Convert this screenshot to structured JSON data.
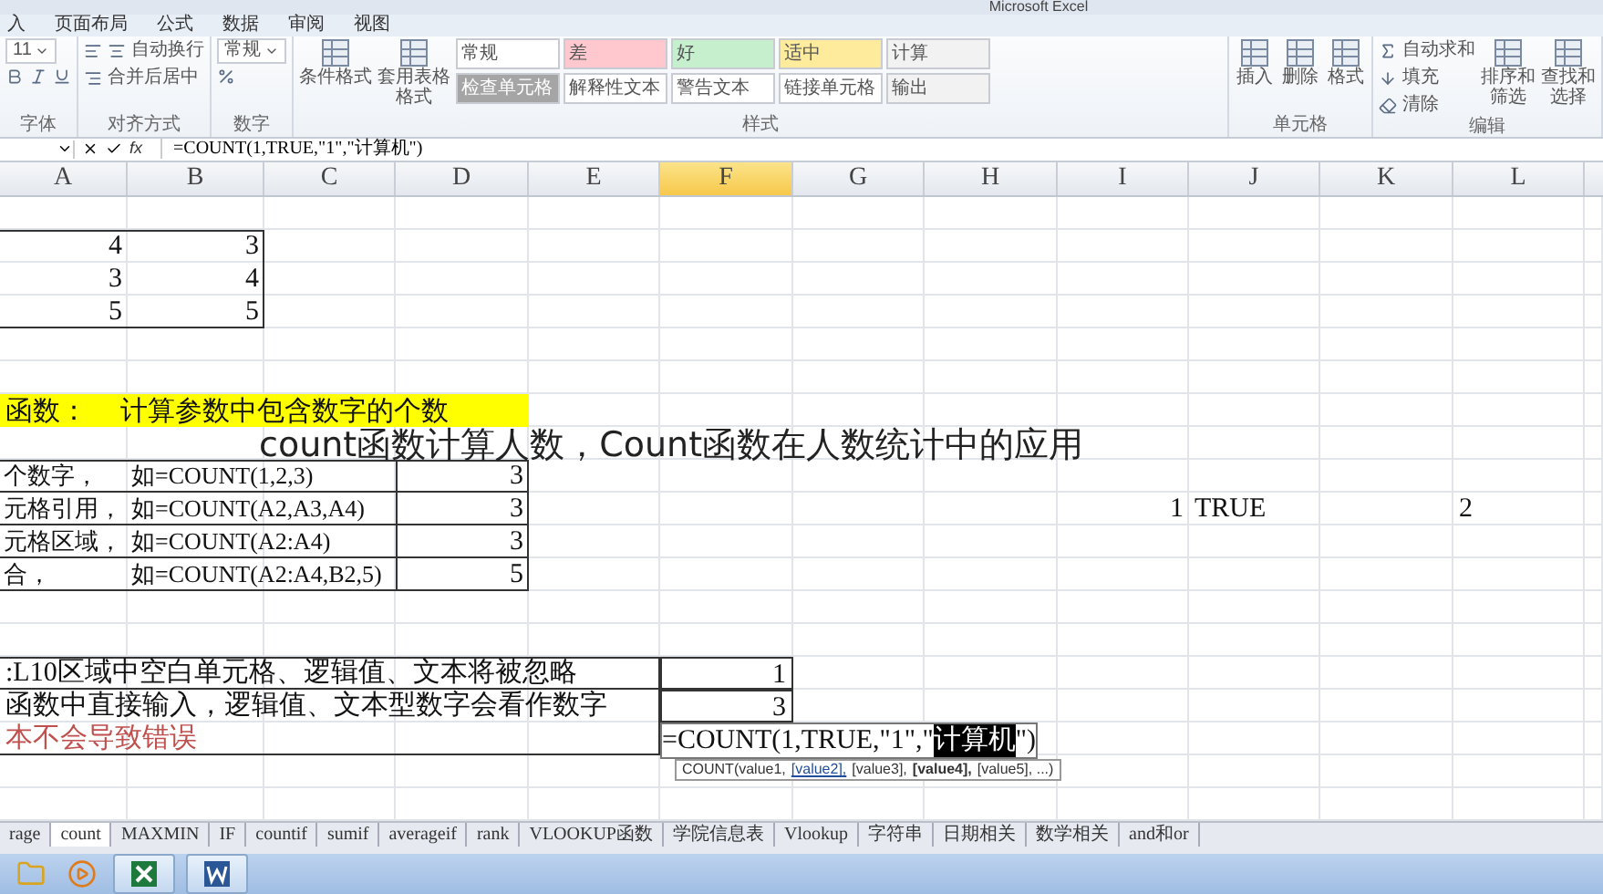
{
  "window": {
    "title": "Microsoft Excel"
  },
  "menu_tabs": [
    {
      "label": "入",
      "selected": false
    },
    {
      "label": "页面布局",
      "selected": false
    },
    {
      "label": "公式",
      "selected": false
    },
    {
      "label": "数据",
      "selected": false
    },
    {
      "label": "审阅",
      "selected": false
    },
    {
      "label": "视图",
      "selected": false
    }
  ],
  "ribbon": {
    "groups": [
      {
        "label": "字体",
        "kind": "font",
        "items": [
          {
            "kind": "field",
            "label": "11"
          }
        ]
      },
      {
        "label": "对齐方式",
        "kind": "align",
        "items": [
          {
            "kind": "small",
            "label": "自动换行"
          },
          {
            "kind": "small",
            "label": "合并后居中"
          }
        ]
      },
      {
        "label": "数字",
        "kind": "number",
        "items": [
          {
            "kind": "field",
            "label": "常规"
          }
        ]
      },
      {
        "label": "样式",
        "kind": "styles",
        "items": [
          {
            "kind": "big",
            "label": "条件格式"
          },
          {
            "kind": "big",
            "label": "套用表格格式"
          }
        ],
        "swatches": [
          {
            "label": "常规",
            "color": "#ffffff"
          },
          {
            "label": "差",
            "color": "#ffc7ce"
          },
          {
            "label": "好",
            "color": "#c6efce"
          },
          {
            "label": "适中",
            "color": "#ffeb9c"
          },
          {
            "label": "计算",
            "color": "#f2f2f2"
          },
          {
            "label": "检查单元格",
            "color": "#a5a5a5"
          },
          {
            "label": "解释性文本",
            "color": "#ffffff"
          },
          {
            "label": "警告文本",
            "color": "#ffffff"
          },
          {
            "label": "链接单元格",
            "color": "#ffffff"
          },
          {
            "label": "输出",
            "color": "#f2f2f2"
          }
        ]
      },
      {
        "label": "单元格",
        "kind": "cells",
        "items": [
          {
            "kind": "big",
            "label": "插入"
          },
          {
            "kind": "big",
            "label": "删除"
          },
          {
            "kind": "big",
            "label": "格式"
          }
        ]
      },
      {
        "label": "编辑",
        "kind": "editing",
        "items": [
          {
            "kind": "small",
            "label": "自动求和"
          },
          {
            "kind": "small",
            "label": "填充"
          },
          {
            "kind": "small",
            "label": "清除"
          },
          {
            "kind": "big",
            "label": "排序和筛选"
          },
          {
            "kind": "big",
            "label": "查找和选择"
          }
        ]
      }
    ]
  },
  "formula_bar": {
    "fx": "fx",
    "formula": "=COUNT(1,TRUE,\"1\",\"计算机\")"
  },
  "columns": [
    {
      "label": "A",
      "selected": false
    },
    {
      "label": "B",
      "selected": false
    },
    {
      "label": "C",
      "selected": false
    },
    {
      "label": "D",
      "selected": false
    },
    {
      "label": "E",
      "selected": false
    },
    {
      "label": "F",
      "selected": true
    },
    {
      "label": "G",
      "selected": false
    },
    {
      "label": "H",
      "selected": false
    },
    {
      "label": "I",
      "selected": false
    },
    {
      "label": "J",
      "selected": false
    },
    {
      "label": "K",
      "selected": false
    },
    {
      "label": "L",
      "selected": false
    }
  ],
  "number_table": {
    "rows": [
      [
        "4",
        "3"
      ],
      [
        "3",
        "4"
      ],
      [
        "5",
        "5"
      ]
    ]
  },
  "function_heading": {
    "name": "函数：",
    "description": "计算参数中包含数字的个数"
  },
  "examples": [
    {
      "text": "个数字，",
      "formula": "如=COUNT(1,2,3)",
      "result": "3"
    },
    {
      "text": "元格引用，",
      "formula": "如=COUNT(A2,A3,A4)",
      "result": "3"
    },
    {
      "text": "元格区域，",
      "formula": "如=COUNT(A2:A4)",
      "result": "3"
    },
    {
      "text": "合，",
      "formula": "如=COUNT(A2:A4,B2,5)",
      "result": "5"
    }
  ],
  "side_values": {
    "i": "1",
    "j": "TRUE",
    "l": "2"
  },
  "notes": [
    {
      "kind": "normal",
      "text": ":L10区域中空白单元格、逻辑值、文本将被忽略",
      "result": "1"
    },
    {
      "kind": "normal",
      "text": "函数中直接输入，逻辑值、文本型数字会看作数字",
      "result": "3"
    },
    {
      "kind": "warning",
      "text": "本不会导致错误"
    }
  ],
  "cell_editor": {
    "before": "=COUNT(1,TRUE,\"1\",\"",
    "selection": "计算机",
    "after": "\")"
  },
  "tooltip": {
    "parts": [
      {
        "kind": "plain",
        "text": "COUNT(value1,"
      },
      {
        "kind": "current",
        "text": "[value2],"
      },
      {
        "kind": "plain",
        "text": "[value3],"
      },
      {
        "kind": "bold",
        "text": "[value4],"
      },
      {
        "kind": "plain",
        "text": "[value5], ...)"
      }
    ]
  },
  "caption": "count函数计算人数，Count函数在人数统计中的应用",
  "sheet_tabs": [
    {
      "label": "rage",
      "selected": false
    },
    {
      "label": "count",
      "selected": true
    },
    {
      "label": "MAXMIN",
      "selected": false
    },
    {
      "label": "IF",
      "selected": false
    },
    {
      "label": "countif",
      "selected": false
    },
    {
      "label": "sumif",
      "selected": false
    },
    {
      "label": "averageif",
      "selected": false
    },
    {
      "label": "rank",
      "selected": false
    },
    {
      "label": "VLOOKUP函数",
      "selected": false
    },
    {
      "label": "学院信息表",
      "selected": false
    },
    {
      "label": "Vlookup",
      "selected": false
    },
    {
      "label": "字符串",
      "selected": false
    },
    {
      "label": "日期相关",
      "selected": false
    },
    {
      "label": "数学相关",
      "selected": false
    },
    {
      "label": "and和or",
      "selected": false
    }
  ],
  "taskbar": {
    "apps": [
      {
        "kind": "folder",
        "open": false
      },
      {
        "kind": "media",
        "open": false
      },
      {
        "kind": "excel",
        "open": true
      },
      {
        "kind": "word",
        "open": true
      }
    ]
  }
}
